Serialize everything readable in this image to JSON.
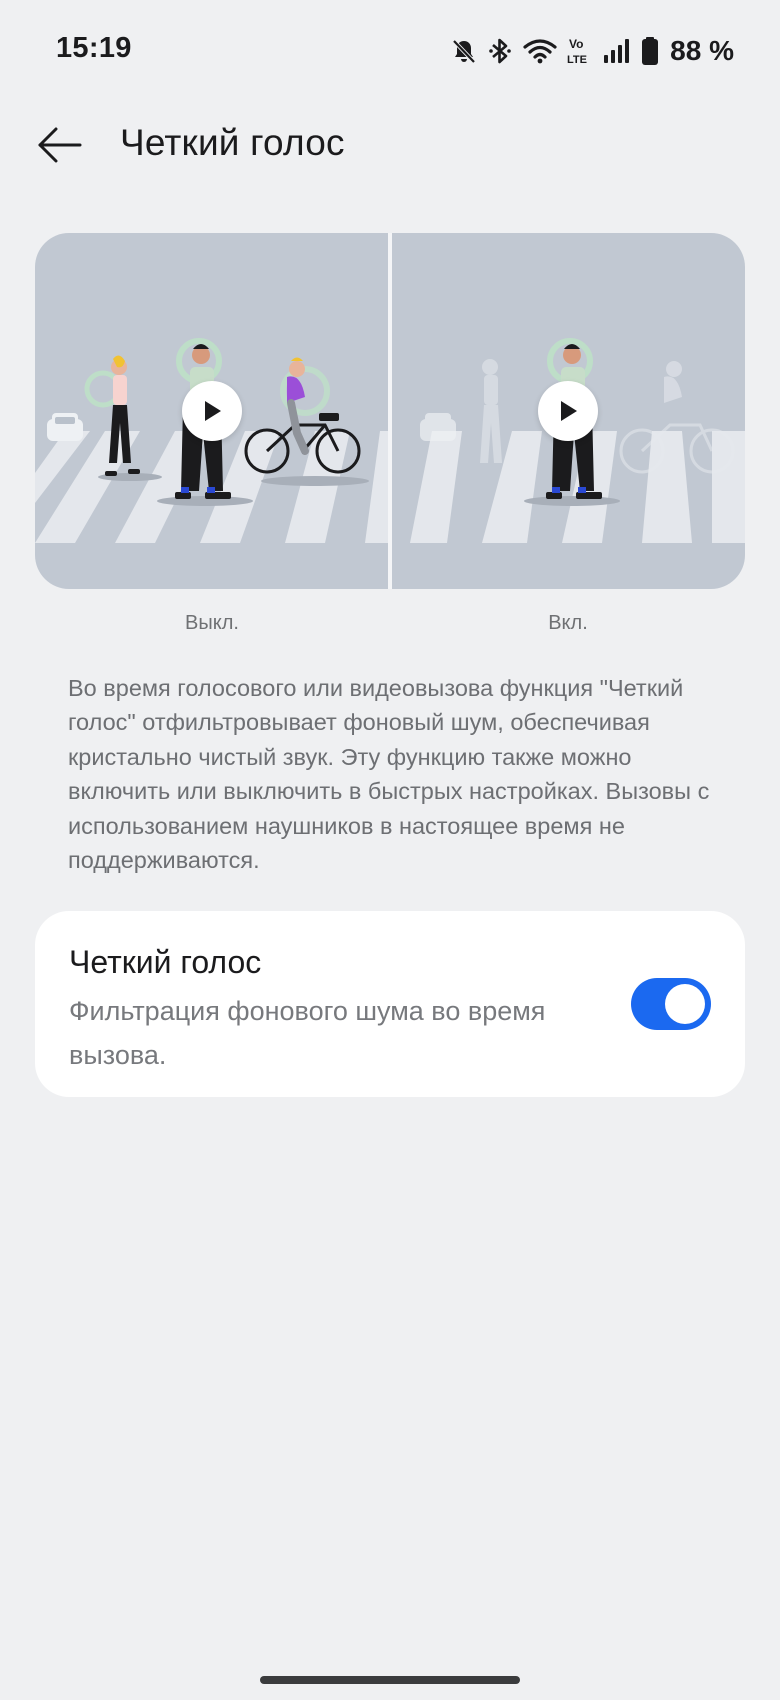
{
  "status_bar": {
    "time": "15:19",
    "icons": [
      "bell-muted-icon",
      "bluetooth-icon",
      "wifi-icon",
      "volte-icon",
      "signal-icon",
      "battery-icon"
    ],
    "battery_percent": "88 %"
  },
  "header": {
    "back_icon": "arrow-left-icon",
    "title": "Четкий голос"
  },
  "preview": {
    "left_caption": "Выкл.",
    "right_caption": "Вкл.",
    "play_icon": "play-icon"
  },
  "description": "Во время голосового или видеовызова функция \"Четкий голос\" отфильтровывает фоновый шум, обеспечивая кристально чистый звук. Эту функцию также можно включить или выключить в быстрых настройках. Вызовы с использованием наушников в настоящее время не поддерживаются.",
  "setting": {
    "title": "Четкий голос",
    "subtitle": "Фильтрация фонового шума во время вызова.",
    "toggle_on": true
  },
  "colors": {
    "background": "#eff0f2",
    "card": "#ffffff",
    "accent": "#1b69f0",
    "illustration_bg": "#c1c8d2"
  }
}
